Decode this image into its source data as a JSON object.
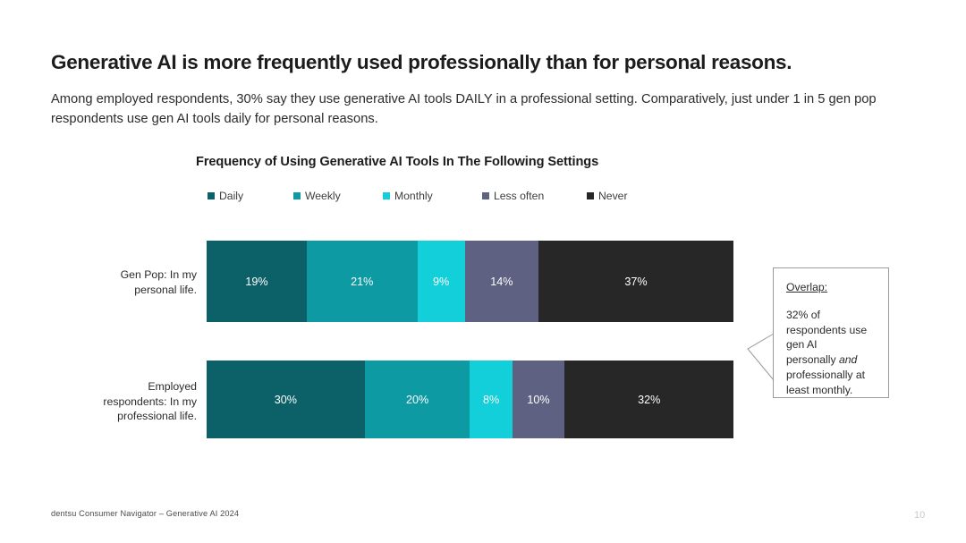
{
  "slide": {
    "headline": "Generative AI is more frequently used professionally than for personal reasons.",
    "subhead": "Among employed respondents, 30% say they use generative AI tools DAILY in a professional setting. Comparatively, just under 1 in 5 gen pop respondents use gen AI tools daily for personal reasons.",
    "footer_note": "dentsu Consumer Navigator –  Generative AI 2024",
    "page_number": "10"
  },
  "callout": {
    "title": "Overlap:",
    "line1": "32% of",
    "line2": "respondents use",
    "line3": "gen AI",
    "line4_pre": "personally ",
    "line4_em": "and",
    "line5": "professionally at",
    "line6": "least monthly.",
    "border_color": "#9a9a9a"
  },
  "chart_data": {
    "type": "bar",
    "orientation": "horizontal",
    "stacked": true,
    "stack_normalized": true,
    "title": "Frequency of Using Generative AI Tools In The Following Settings",
    "xlabel": "",
    "ylabel": "",
    "xlim": [
      0,
      100
    ],
    "grid": false,
    "legend_position": "top",
    "value_suffix": "%",
    "categories": [
      "Gen Pop: In my personal life.",
      "Employed respondents: In my professional life."
    ],
    "category_label_lines": [
      [
        "Gen Pop: In my",
        "personal life."
      ],
      [
        "Employed",
        "respondents: In my",
        "professional life."
      ]
    ],
    "series": [
      {
        "name": "Daily",
        "color": "#0c6068",
        "values": [
          19,
          30
        ],
        "labels": [
          "19%",
          "30%"
        ]
      },
      {
        "name": "Weekly",
        "color": "#0d9aa3",
        "values": [
          21,
          20
        ],
        "labels": [
          "21%",
          "20%"
        ]
      },
      {
        "name": "Monthly",
        "color": "#12cfd9",
        "values": [
          9,
          8
        ],
        "labels": [
          "9%",
          "8%"
        ]
      },
      {
        "name": "Less often",
        "color": "#5f6182",
        "values": [
          14,
          10
        ],
        "labels": [
          "14%",
          "10%"
        ]
      },
      {
        "name": "Never",
        "color": "#272727",
        "values": [
          37,
          32
        ],
        "labels": [
          "37%",
          "32%"
        ]
      }
    ],
    "legend_x_positions": [
      0,
      96,
      196,
      307,
      424
    ]
  }
}
